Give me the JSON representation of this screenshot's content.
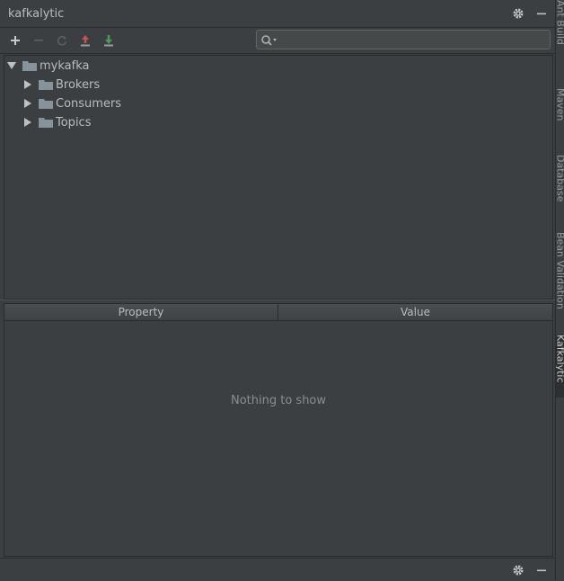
{
  "window": {
    "title": "kafkalytic"
  },
  "title_bar": {
    "settings_icon": "gear-icon",
    "hide_icon": "minimize-icon"
  },
  "toolbar": {
    "buttons": [
      {
        "name": "add",
        "icon": "plus-icon",
        "enabled": true
      },
      {
        "name": "remove",
        "icon": "minus-icon",
        "enabled": false
      },
      {
        "name": "refresh",
        "icon": "refresh-icon",
        "enabled": false
      },
      {
        "name": "upload",
        "icon": "upload-icon",
        "enabled": true,
        "color": "#c75450"
      },
      {
        "name": "download",
        "icon": "download-icon",
        "enabled": true,
        "color": "#499c54"
      }
    ],
    "search": {
      "value": "",
      "placeholder": ""
    }
  },
  "tree": {
    "root": {
      "label": "mykafka",
      "expanded": true
    },
    "children": [
      {
        "label": "Brokers",
        "expanded": false
      },
      {
        "label": "Consumers",
        "expanded": false
      },
      {
        "label": "Topics",
        "expanded": false
      }
    ]
  },
  "table": {
    "columns": [
      "Property",
      "Value"
    ],
    "rows": [],
    "empty_text": "Nothing to show"
  },
  "right_tool_tabs": [
    {
      "label": "Ant Build",
      "active": false
    },
    {
      "label": "Maven",
      "active": false
    },
    {
      "label": "Database",
      "active": false
    },
    {
      "label": "Bean Validation",
      "active": false
    },
    {
      "label": "Kafkalytic",
      "active": true
    }
  ],
  "colors": {
    "background": "#3c3f41",
    "folder": "#87939a",
    "text": "#bbbbbb"
  }
}
